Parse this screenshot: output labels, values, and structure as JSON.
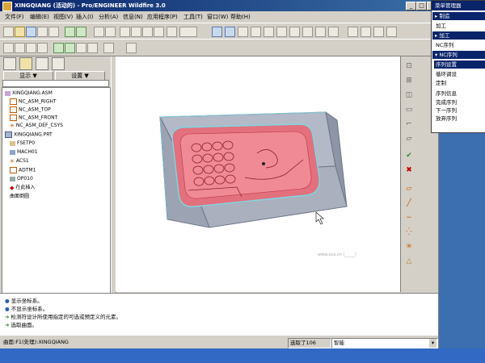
{
  "window": {
    "title": "XINGQIANG (活动的) - Pro/ENGINEER Wildfire 3.0",
    "controls": [
      "_",
      "□",
      "×"
    ]
  },
  "menu": [
    "文件(F)",
    "编辑(E)",
    "视图(V)",
    "插入(I)",
    "分析(A)",
    "信息(N)",
    "应用程序(P)",
    "工具(T)",
    "窗口(W)",
    "帮助(H)"
  ],
  "navigator": {
    "show_label": "显示 ▼",
    "settings_label": "设置 ▼",
    "tree": [
      "XINGQIANG.ASM",
      "NC_ASM_RIGHT",
      "NC_ASM_TOP",
      "NC_ASM_FRONT",
      "NC_ASM_DEF_CSYS",
      "XINGQIANG.PRT",
      "FSETP0",
      "MACH01",
      "ACS1",
      "ADTM1",
      "OP010",
      "在此插入",
      "曲面倒圆"
    ]
  },
  "graphics": {
    "watermark": "www.xxx.cn (_____)"
  },
  "messages": [
    "显示坐标系。",
    "不显示坐标系。",
    "检测符设计所使用指定的可选或预定义的元素。",
    "选取曲面。"
  ],
  "status": {
    "left": "曲面:F1(处理):XINGQIANG",
    "selected": "选取了106",
    "filter": "智能"
  },
  "menu_manager": {
    "title": "菜单管理器",
    "sections": [
      {
        "header": "制造",
        "items": [
          "加工"
        ]
      },
      {
        "header": "加工",
        "items": [
          "NC序列"
        ]
      },
      {
        "header": "NC序列",
        "items": [
          "序列设置",
          "循环调设",
          "定制",
          "序列信息",
          "完成序列",
          "下一序列",
          "放弃序列"
        ]
      }
    ],
    "selected": "序列设置"
  },
  "colors": {
    "title_bar": "#0a246a",
    "desktop": "#3c6fb0",
    "part_red": "#e05060",
    "block_gray": "#b0b6c4"
  }
}
